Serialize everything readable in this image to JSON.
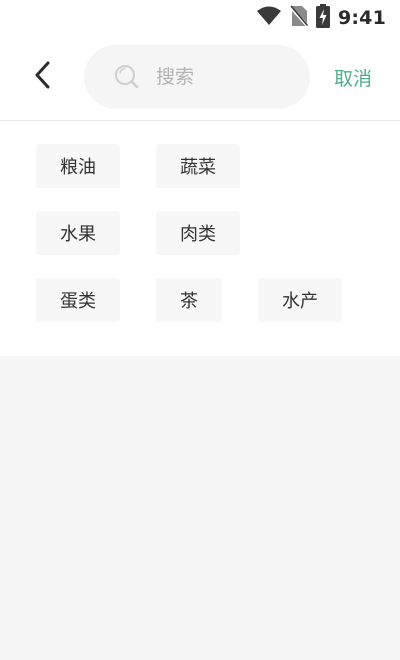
{
  "status_bar": {
    "time": "9:41",
    "icons": [
      "wifi-icon",
      "no-sim-icon",
      "battery-charging-icon"
    ]
  },
  "header": {
    "back_icon": "chevron-left-icon",
    "search": {
      "placeholder": "搜索",
      "value": "",
      "icon": "search-icon"
    },
    "cancel_label": "取消"
  },
  "tags": [
    [
      "粮油",
      "蔬菜"
    ],
    [
      "水果",
      "肉类"
    ],
    [
      "蛋类",
      "茶",
      "水产"
    ]
  ],
  "colors": {
    "accent": "#4dae8a",
    "background": "#f5f5f5",
    "surface": "#ffffff",
    "tag_bg": "#f7f7f7"
  }
}
